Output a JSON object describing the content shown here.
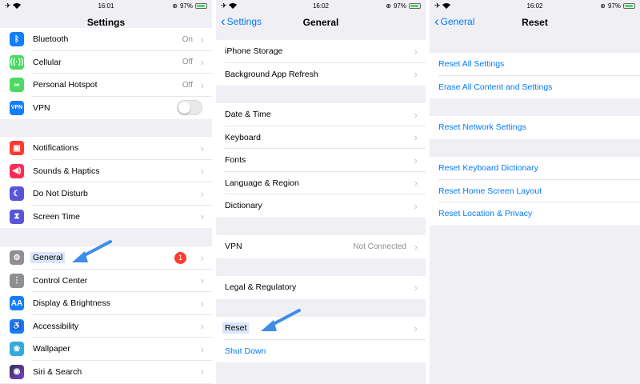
{
  "status_bar": {
    "p1": {
      "time": "16:01",
      "battery": "97%"
    },
    "p2": {
      "time": "16:02",
      "battery": "97%"
    },
    "p3": {
      "time": "16:02",
      "battery": "97%"
    }
  },
  "settings": {
    "title": "Settings",
    "group1": [
      {
        "label": "Bluetooth",
        "value": "On",
        "icon_color": "#147efb"
      },
      {
        "label": "Cellular",
        "value": "Off",
        "icon_color": "#4cd964"
      },
      {
        "label": "Personal Hotspot",
        "value": "Off",
        "icon_color": "#4cd964"
      },
      {
        "label": "VPN",
        "icon_text": "VPN",
        "icon_color": "#147efb"
      }
    ],
    "group2": [
      {
        "label": "Notifications",
        "icon_color": "#ff3b30"
      },
      {
        "label": "Sounds & Haptics",
        "icon_color": "#ff2d55"
      },
      {
        "label": "Do Not Disturb",
        "icon_color": "#5856d6"
      },
      {
        "label": "Screen Time",
        "icon_color": "#5856d6"
      }
    ],
    "group3": [
      {
        "label": "General",
        "badge": "1",
        "icon_color": "#8e8e93"
      },
      {
        "label": "Control Center",
        "icon_color": "#8e8e93"
      },
      {
        "label": "Display & Brightness",
        "icon_text": "AA",
        "icon_color": "#147efb"
      },
      {
        "label": "Accessibility",
        "icon_color": "#147efb"
      },
      {
        "label": "Wallpaper",
        "icon_color": "#34aadc"
      },
      {
        "label": "Siri & Search",
        "icon_color": "#333344"
      }
    ]
  },
  "general": {
    "title": "General",
    "back_label": "Settings",
    "group1": [
      "iPhone Storage",
      "Background App Refresh"
    ],
    "group2": [
      "Date & Time",
      "Keyboard",
      "Fonts",
      "Language & Region",
      "Dictionary"
    ],
    "vpn": {
      "label": "VPN",
      "value": "Not Connected"
    },
    "legal": "Legal & Regulatory",
    "reset": "Reset",
    "shutdown": "Shut Down"
  },
  "reset": {
    "title": "Reset",
    "back_label": "General",
    "group1": [
      "Reset All Settings",
      "Erase All Content and Settings"
    ],
    "group2": [
      "Reset Network Settings"
    ],
    "group3": [
      "Reset Keyboard Dictionary",
      "Reset Home Screen Layout",
      "Reset Location & Privacy"
    ]
  }
}
